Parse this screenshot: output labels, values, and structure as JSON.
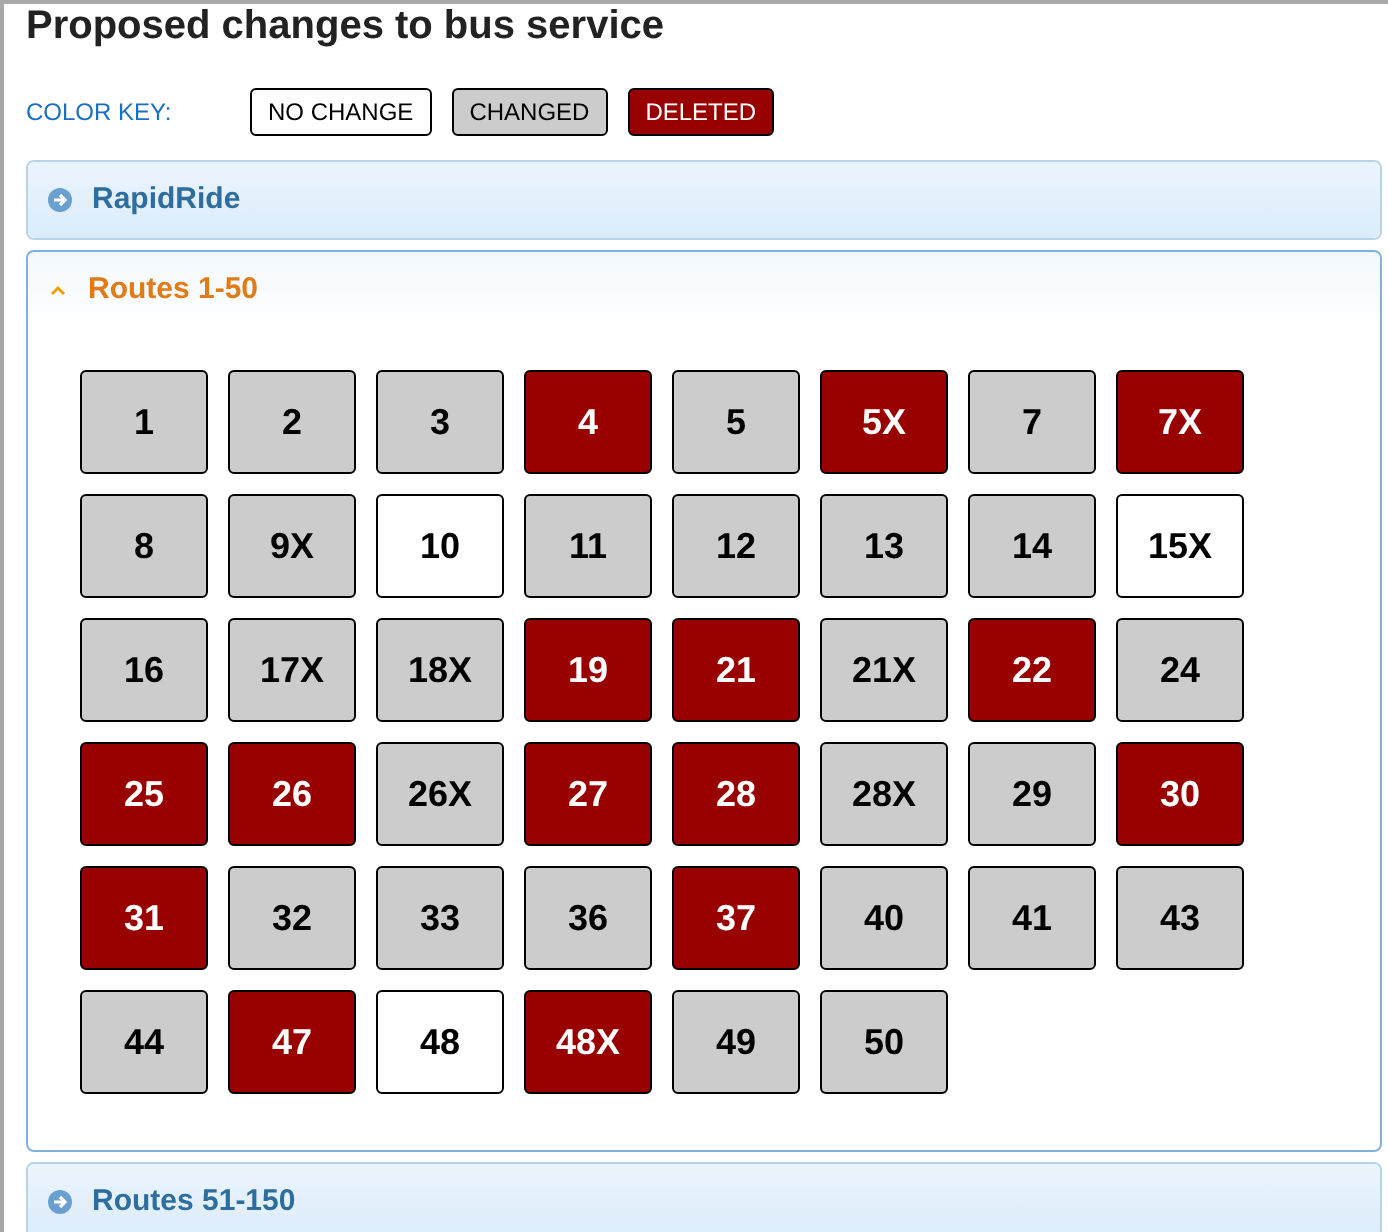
{
  "title": "Proposed changes to bus service",
  "color_key": {
    "label": "COLOR KEY:",
    "items": [
      {
        "label": "NO CHANGE",
        "kind": "no_change"
      },
      {
        "label": "CHANGED",
        "kind": "changed"
      },
      {
        "label": "DELETED",
        "kind": "deleted"
      }
    ]
  },
  "panels": [
    {
      "title": "RapidRide",
      "expanded": false
    },
    {
      "title": "Routes 1-50",
      "expanded": true,
      "routes": [
        {
          "label": "1",
          "kind": "changed"
        },
        {
          "label": "2",
          "kind": "changed"
        },
        {
          "label": "3",
          "kind": "changed"
        },
        {
          "label": "4",
          "kind": "deleted"
        },
        {
          "label": "5",
          "kind": "changed"
        },
        {
          "label": "5X",
          "kind": "deleted"
        },
        {
          "label": "7",
          "kind": "changed"
        },
        {
          "label": "7X",
          "kind": "deleted"
        },
        {
          "label": "8",
          "kind": "changed"
        },
        {
          "label": "9X",
          "kind": "changed"
        },
        {
          "label": "10",
          "kind": "no_change"
        },
        {
          "label": "11",
          "kind": "changed"
        },
        {
          "label": "12",
          "kind": "changed"
        },
        {
          "label": "13",
          "kind": "changed"
        },
        {
          "label": "14",
          "kind": "changed"
        },
        {
          "label": "15X",
          "kind": "no_change"
        },
        {
          "label": "16",
          "kind": "changed"
        },
        {
          "label": "17X",
          "kind": "changed"
        },
        {
          "label": "18X",
          "kind": "changed"
        },
        {
          "label": "19",
          "kind": "deleted"
        },
        {
          "label": "21",
          "kind": "deleted"
        },
        {
          "label": "21X",
          "kind": "changed"
        },
        {
          "label": "22",
          "kind": "deleted"
        },
        {
          "label": "24",
          "kind": "changed"
        },
        {
          "label": "25",
          "kind": "deleted"
        },
        {
          "label": "26",
          "kind": "deleted"
        },
        {
          "label": "26X",
          "kind": "changed"
        },
        {
          "label": "27",
          "kind": "deleted"
        },
        {
          "label": "28",
          "kind": "deleted"
        },
        {
          "label": "28X",
          "kind": "changed"
        },
        {
          "label": "29",
          "kind": "changed"
        },
        {
          "label": "30",
          "kind": "deleted"
        },
        {
          "label": "31",
          "kind": "deleted"
        },
        {
          "label": "32",
          "kind": "changed"
        },
        {
          "label": "33",
          "kind": "changed"
        },
        {
          "label": "36",
          "kind": "changed"
        },
        {
          "label": "37",
          "kind": "deleted"
        },
        {
          "label": "40",
          "kind": "changed"
        },
        {
          "label": "41",
          "kind": "changed"
        },
        {
          "label": "43",
          "kind": "changed"
        },
        {
          "label": "44",
          "kind": "changed"
        },
        {
          "label": "47",
          "kind": "deleted"
        },
        {
          "label": "48",
          "kind": "no_change"
        },
        {
          "label": "48X",
          "kind": "deleted"
        },
        {
          "label": "49",
          "kind": "changed"
        },
        {
          "label": "50",
          "kind": "changed"
        }
      ]
    },
    {
      "title": "Routes 51-150",
      "expanded": false
    }
  ]
}
